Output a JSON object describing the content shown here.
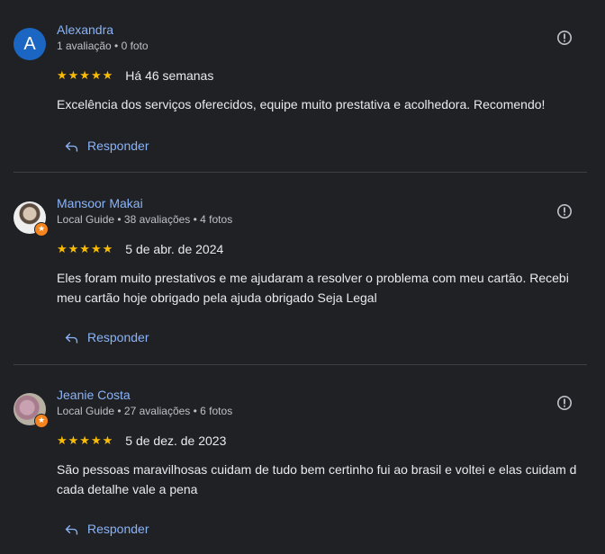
{
  "reviews": [
    {
      "name": "Alexandra",
      "avatar_letter": "A",
      "meta": "1 avaliação • 0 foto",
      "stars": "★★★★★",
      "date": "Há 46 semanas",
      "text": "Excelência dos serviços oferecidos, equipe muito prestativa e acolhedora. Recomendo!",
      "reply_label": "Responder"
    },
    {
      "name": "Mansoor Makai",
      "meta": "Local Guide • 38 avaliações • 4 fotos",
      "stars": "★★★★★",
      "date": "5 de abr. de 2024",
      "text": "Eles foram muito prestativos e me ajudaram a resolver o problema com meu cartão. Recebi meu cartão hoje obrigado pela ajuda obrigado Seja Legal",
      "reply_label": "Responder"
    },
    {
      "name": "Jeanie Costa",
      "meta": "Local Guide • 27 avaliações • 6 fotos",
      "stars": "★★★★★",
      "date": "5 de dez. de 2023",
      "text": "São pessoas maravilhosas cuidam de tudo bem certinho fui ao brasil e voltei e elas cuidam d cada detalhe vale a pena",
      "reply_label": "Responder"
    }
  ],
  "colors": {
    "background": "#202124",
    "name_link": "#8ab4f8",
    "star": "#fbbc04",
    "divider": "#3c4043",
    "local_guide_badge": "#f5841f"
  },
  "icons": {
    "flag": "report-icon",
    "reply": "reply-arrow-icon",
    "local_guide": "local-guide-badge-icon"
  }
}
